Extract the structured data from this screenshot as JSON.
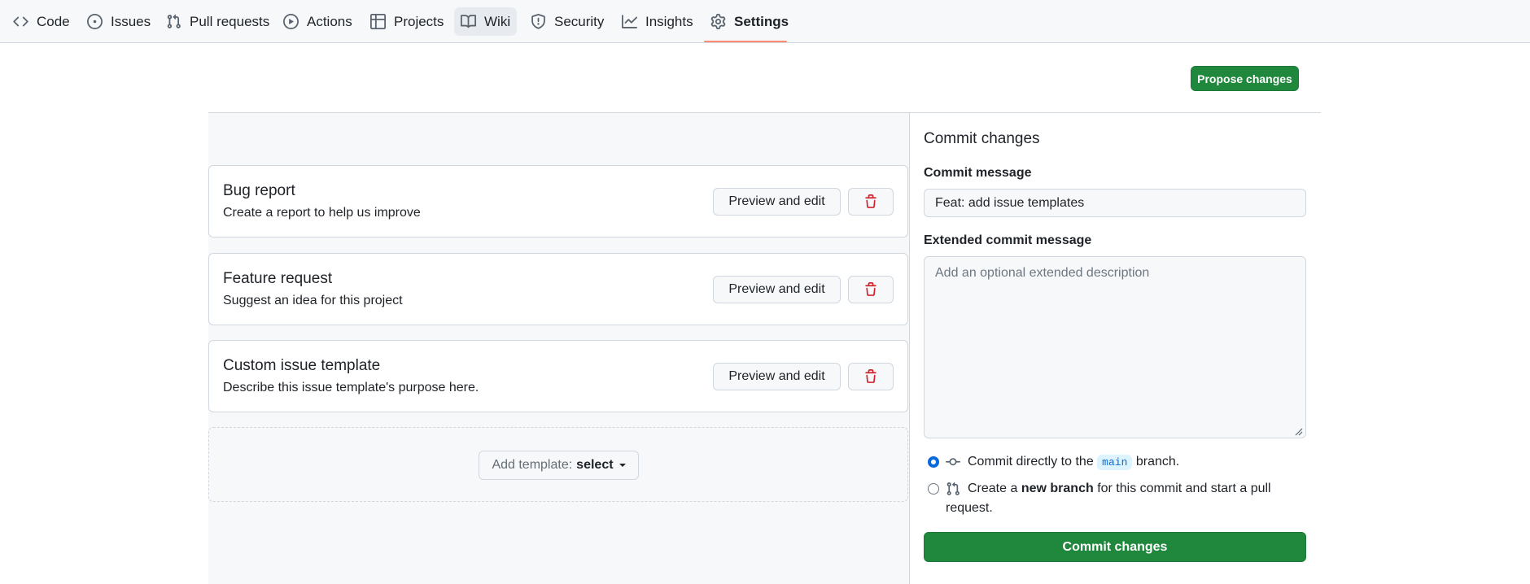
{
  "nav": {
    "tabs": [
      {
        "label": "Code",
        "icon": "code-icon"
      },
      {
        "label": "Issues",
        "icon": "issue-opened-icon"
      },
      {
        "label": "Pull requests",
        "icon": "git-pull-request-icon"
      },
      {
        "label": "Actions",
        "icon": "play-icon"
      },
      {
        "label": "Projects",
        "icon": "table-icon"
      },
      {
        "label": "Wiki",
        "icon": "book-icon"
      },
      {
        "label": "Security",
        "icon": "shield-icon"
      },
      {
        "label": "Insights",
        "icon": "graph-icon"
      },
      {
        "label": "Settings",
        "icon": "gear-icon"
      }
    ],
    "selected": "Settings",
    "hovered": "Wiki"
  },
  "toolbar": {
    "propose_label": "Propose changes"
  },
  "templates": [
    {
      "name": "Bug report",
      "description": "Create a report to help us improve",
      "preview_label": "Preview and edit"
    },
    {
      "name": "Feature request",
      "description": "Suggest an idea for this project",
      "preview_label": "Preview and edit"
    },
    {
      "name": "Custom issue template",
      "description": "Describe this issue template's purpose here.",
      "preview_label": "Preview and edit"
    }
  ],
  "add_template": {
    "prefix": "Add template:",
    "selected": "select"
  },
  "commit": {
    "title": "Commit changes",
    "message_label": "Commit message",
    "message_value": "Feat: add issue templates",
    "extended_label": "Extended commit message",
    "extended_placeholder": "Add an optional extended description",
    "option_direct": {
      "prefix": "Commit directly to the",
      "branch": "main",
      "suffix": "branch."
    },
    "option_new": {
      "prefix": "Create a",
      "bold": "new branch",
      "suffix": "for this commit and start a pull request."
    },
    "commit_button": "Commit changes"
  },
  "colors": {
    "accent_green": "#1f883d",
    "tab_underline": "#fd8c73",
    "danger": "#d1242f",
    "radio_blue": "#0969da"
  }
}
